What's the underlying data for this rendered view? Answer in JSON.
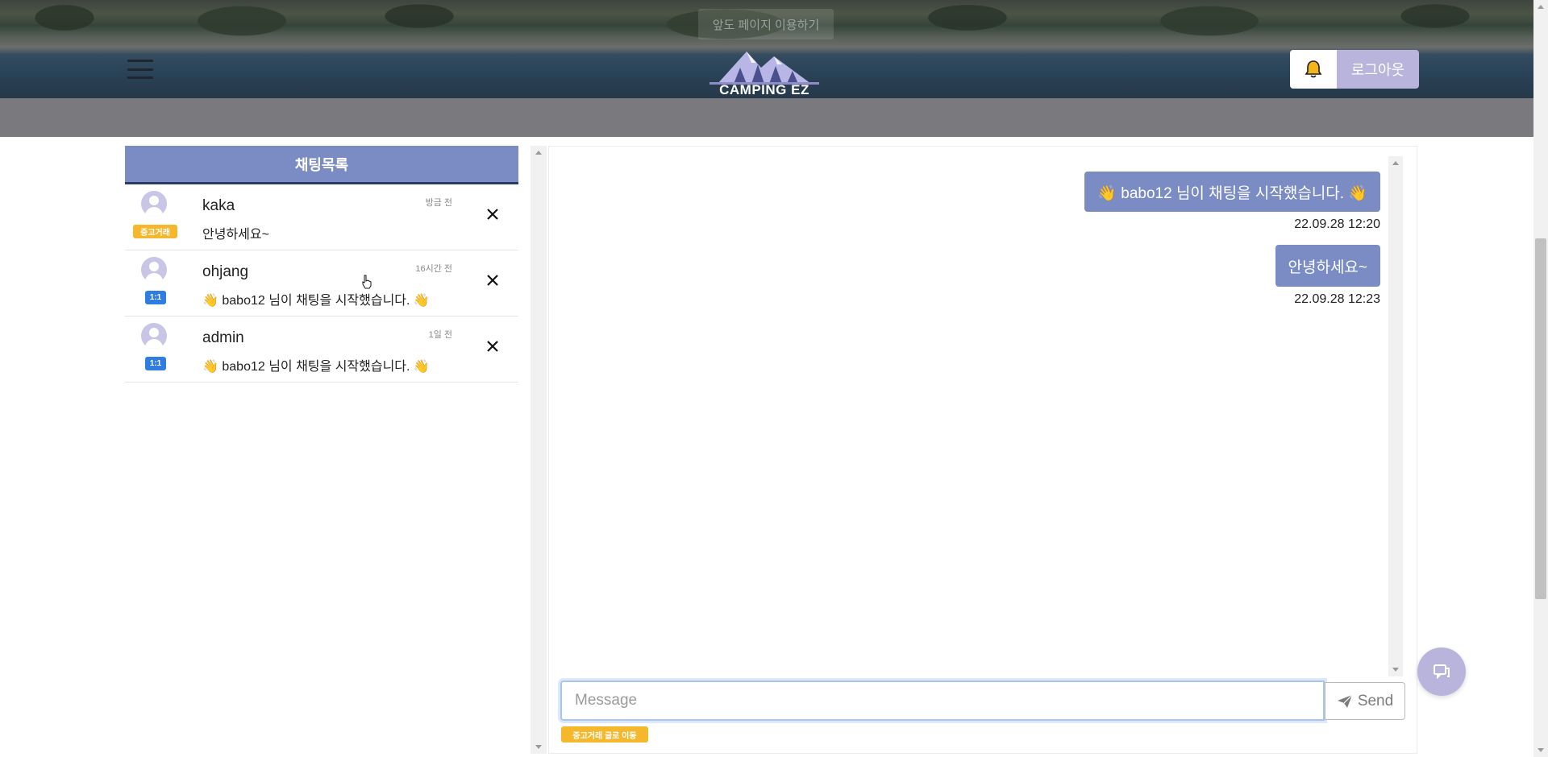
{
  "header": {
    "notice": "앞도 페이지 이용하기",
    "logo_text": "CAMPING EZ",
    "logout_label": "로그아웃",
    "icons": {
      "menu": "hamburger-icon",
      "bell": "bell-icon"
    },
    "colors": {
      "logout_bg": "#b9b4dc",
      "bell_icon": "#f2b61a"
    }
  },
  "chat_list": {
    "title": "채팅목록",
    "items": [
      {
        "name": "kaka",
        "time": "방금 전",
        "preview": "안녕하세요~",
        "tag": "중고거래",
        "tag_type": "used"
      },
      {
        "name": "ohjang",
        "time": "16시간 전",
        "preview": "👋 babo12 님이 채팅을 시작했습니다. 👋",
        "tag": "1:1",
        "tag_type": "oneone"
      },
      {
        "name": "admin",
        "time": "1일 전",
        "preview": "👋 babo12 님이 채팅을 시작했습니다. 👋",
        "tag": "1:1",
        "tag_type": "oneone"
      }
    ]
  },
  "chat_room": {
    "messages": [
      {
        "text": "👋 babo12 님이 채팅을 시작했습니다. 👋",
        "time": "22.09.28 12:20"
      },
      {
        "text": "안녕하세요~",
        "time": "22.09.28 12:23"
      }
    ],
    "input_placeholder": "Message",
    "send_label": "Send",
    "goto_label": "중고거래 글로 이동"
  },
  "colors": {
    "accent": "#7b8cc4",
    "tag_used": "#f5b72b",
    "tag_oneone": "#2f7de1",
    "fab": "#b9b4dc"
  }
}
